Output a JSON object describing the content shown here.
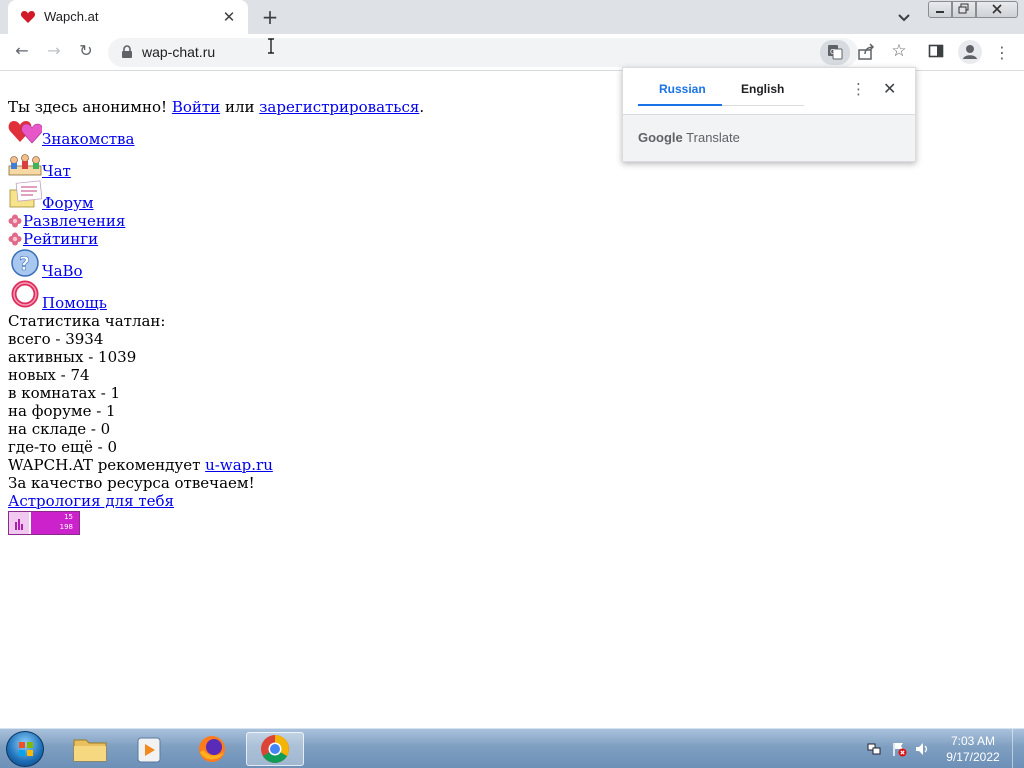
{
  "browser": {
    "tab_title": "Wapch.at",
    "url": "wap-chat.ru",
    "new_tab_symbol": "+",
    "tab_close_symbol": "✕",
    "menu_symbol": "⋮",
    "star_symbol": "☆",
    "back_symbol": "←",
    "forward_symbol": "→",
    "reload_symbol": "↻"
  },
  "translate_popup": {
    "lang_source": "Russian",
    "lang_target": "English",
    "brand_google": "Google",
    "brand_translate": "Translate",
    "more_symbol": "⋮",
    "close_symbol": "✕"
  },
  "page": {
    "anon_prefix": "Ты здесь анонимно! ",
    "login_link": "Войти",
    "or_text": " или ",
    "register_link": "зарегистрироваться",
    "anon_suffix": ".",
    "menu": [
      {
        "label": "Знакомства",
        "icon": "hearts-icon"
      },
      {
        "label": "Чат",
        "icon": "chat-people-icon"
      },
      {
        "label": "Форум",
        "icon": "forum-notes-icon"
      },
      {
        "label": "Развлечения",
        "icon": "flower-icon"
      },
      {
        "label": "Рейтинги",
        "icon": "flower-icon"
      },
      {
        "label": "ЧаВо",
        "icon": "question-icon"
      },
      {
        "label": "Помощь",
        "icon": "lifebuoy-icon"
      }
    ],
    "stats_title": "Статистика чатлан:",
    "stats": [
      "всего - 3934",
      "активных - 1039",
      "новых - 74",
      "в комнатах - 1",
      "на форуме - 1",
      "на складе - 0",
      "где-то ещё - 0"
    ],
    "recommend_prefix": "WAPCH.AT рекомендует ",
    "recommend_link": "u-wap.ru",
    "quality_text": "За качество ресурса отвечаем!",
    "astro_link": "Астрология для тебя",
    "counter_top": "15",
    "counter_bottom": "198"
  },
  "taskbar": {
    "time": "7:03 AM",
    "date": "9/17/2022"
  },
  "colors": {
    "link": "#0000ee",
    "translate_accent": "#1a73e8",
    "counter_magenta": "#cc22cc"
  }
}
